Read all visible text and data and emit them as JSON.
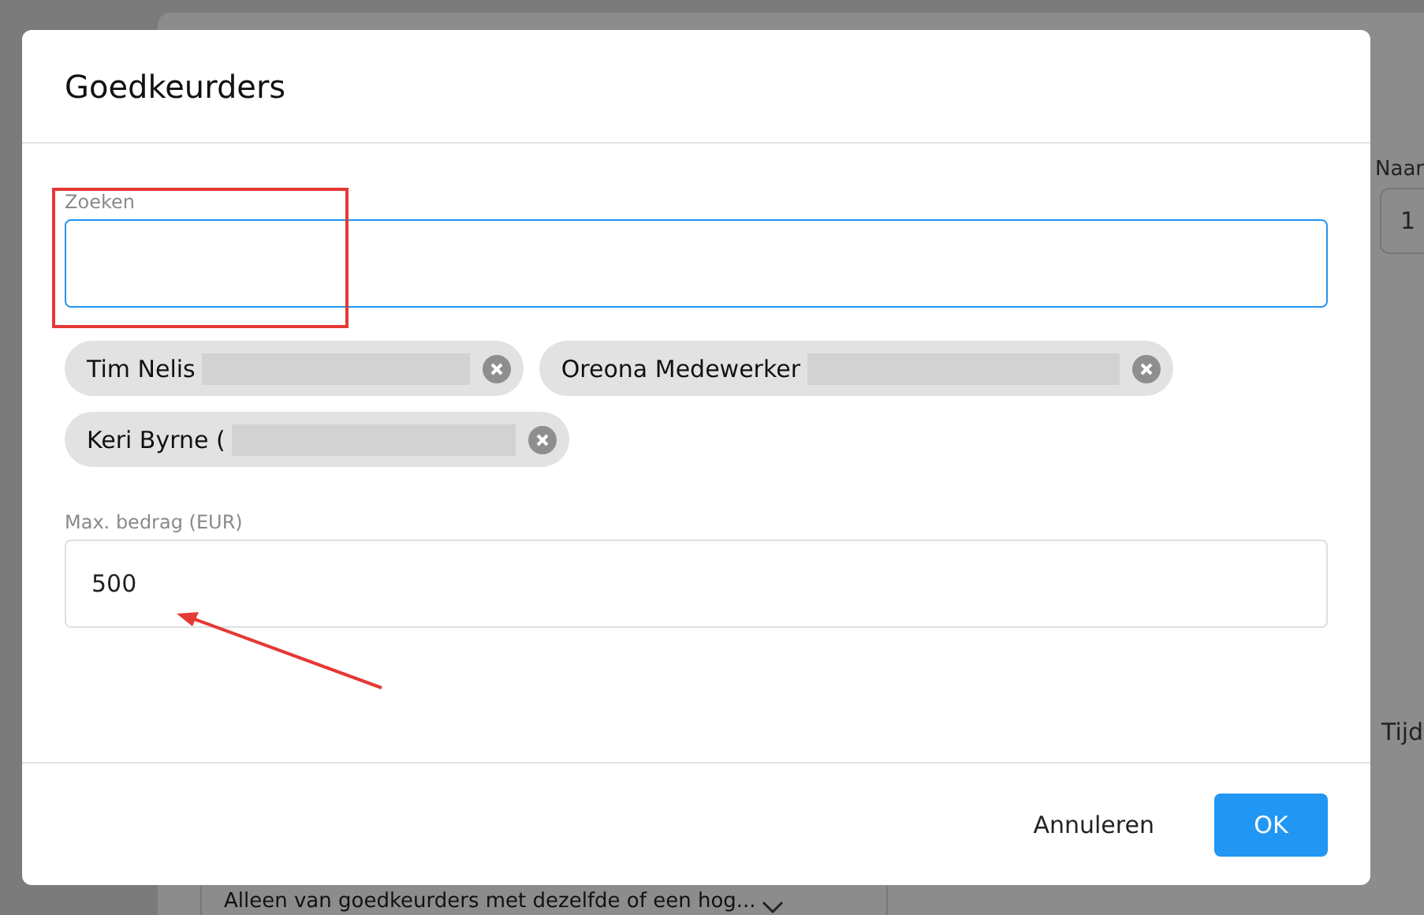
{
  "background": {
    "side_label": "Naar",
    "side_field_value": "1",
    "side_text": "Tijd",
    "dropdown": {
      "value": "Alleen van goedkeurders met dezelfde of een hog..."
    }
  },
  "dialog": {
    "title": "Goedkeurders",
    "search": {
      "label": "Zoeken",
      "focused": true
    },
    "approvers": [
      {
        "name": "Tim Nelis"
      },
      {
        "name": "Oreona Medewerker"
      },
      {
        "name": "Keri Byrne ("
      }
    ],
    "max_amount": {
      "label": "Max. bedrag (EUR)",
      "value": "500"
    },
    "buttons": [
      {
        "label": "Annuleren",
        "kind": "text"
      },
      {
        "label": "OK",
        "kind": "primary"
      }
    ]
  }
}
